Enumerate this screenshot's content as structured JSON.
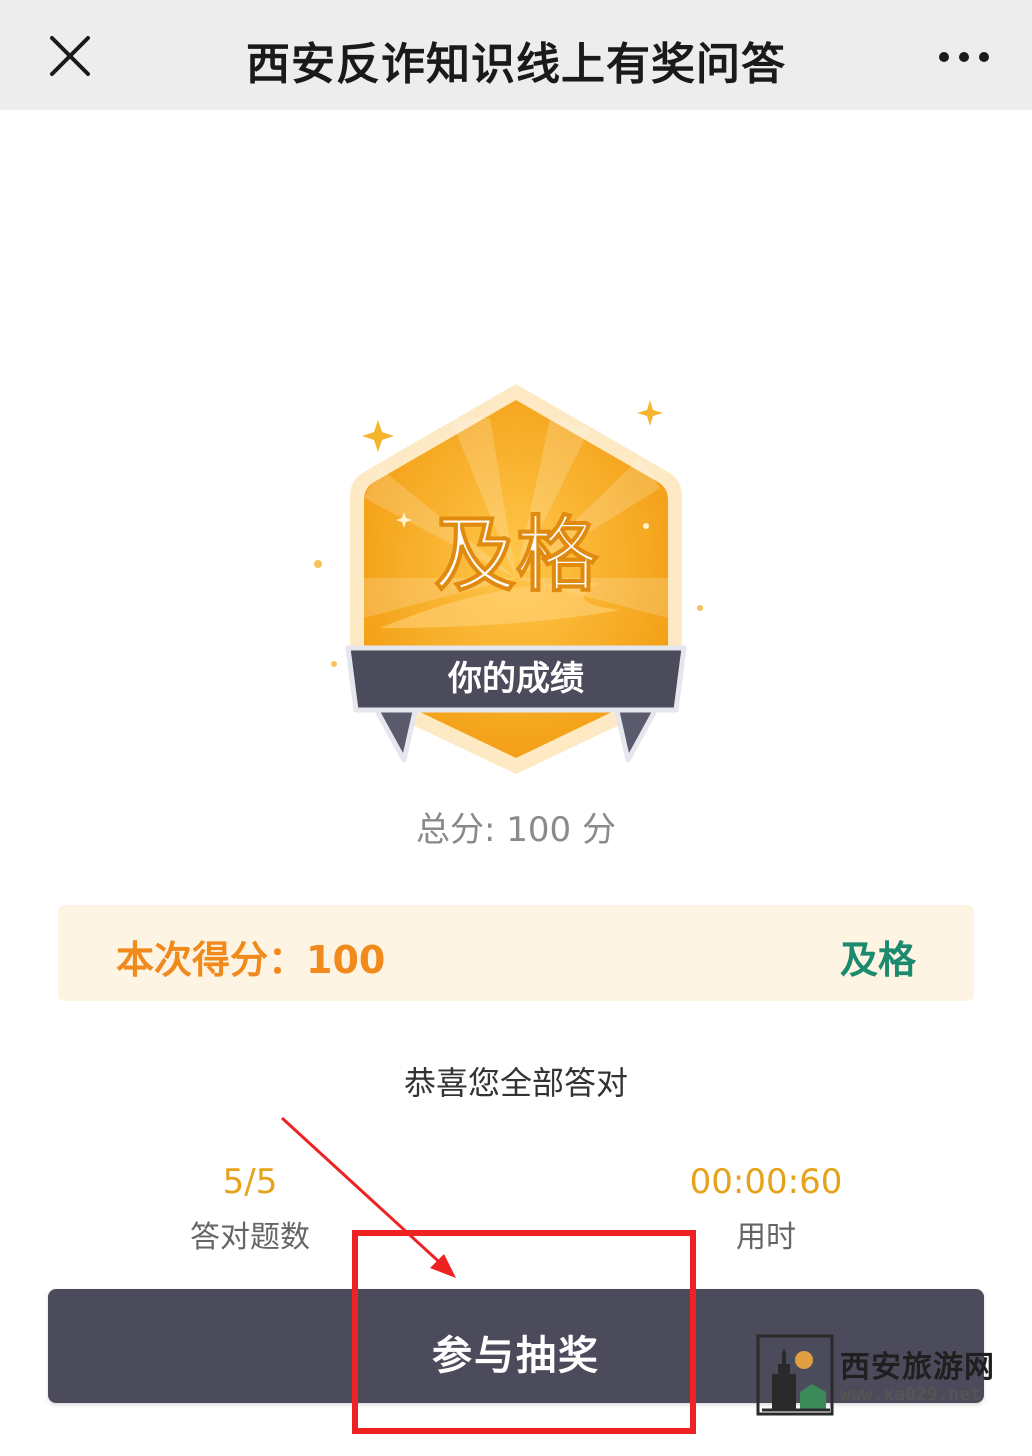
{
  "nav": {
    "title": "西安反诈知识线上有奖问答"
  },
  "badge": {
    "grade": "及格",
    "ribbon": "你的成绩"
  },
  "total": "总分: 100 分",
  "score_card": {
    "label": "本次得分：100",
    "status": "及格"
  },
  "message": "恭喜您全部答对",
  "stats": {
    "correct": {
      "value": "5/5",
      "label": "答对题数"
    },
    "time": {
      "value": "00:00:60",
      "label": "用时"
    }
  },
  "button": {
    "label": "参与抽奖"
  },
  "watermark": {
    "name": "西安旅游网",
    "url": "www.xa029.net"
  },
  "colors": {
    "accent_orange": "#f08a1c",
    "badge_orange": "#f5a623",
    "pass_green": "#1c8a6e",
    "button_dark": "#4b4b5c",
    "annotation_red": "#ee2222"
  }
}
